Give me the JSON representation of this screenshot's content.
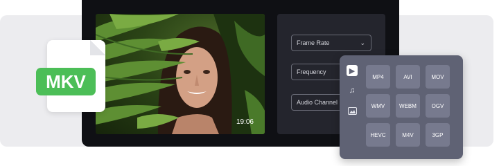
{
  "file_badge": {
    "label": "MKV",
    "color": "#4cbe57"
  },
  "video": {
    "timestamp": "19:06"
  },
  "settings": {
    "frame_rate_label": "Frame Rate",
    "frequency_label": "Frequency",
    "audio_channel_label": "Audio Channel"
  },
  "format_panel": {
    "side_icons": [
      "video-icon",
      "music-icon",
      "image-icon"
    ],
    "formats": [
      "MP4",
      "AVI",
      "MOV",
      "WMV",
      "WEBM",
      "OGV",
      "HEVC",
      "M4V",
      "3GP"
    ]
  }
}
